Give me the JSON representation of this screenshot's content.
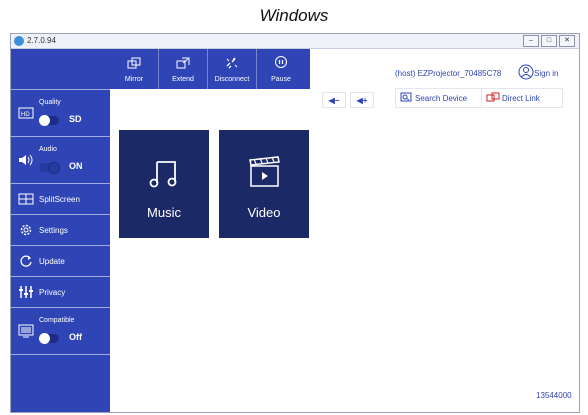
{
  "caption": "Windows",
  "window": {
    "version": "2.7.0.94",
    "controls": [
      "minimize-icon",
      "maximize-icon",
      "close-icon"
    ]
  },
  "toolbar": {
    "buttons": [
      {
        "label": "Mirror",
        "icon": "mirror-icon"
      },
      {
        "label": "Extend",
        "icon": "extend-icon"
      },
      {
        "label": "Disconnect",
        "icon": "disconnect-icon"
      },
      {
        "label": "Pause",
        "icon": "pause-icon"
      }
    ]
  },
  "sidebar": {
    "quality": {
      "label": "Quality",
      "value": "SD",
      "icon": "hd-icon",
      "toggle_on": false
    },
    "audio": {
      "label": "Audio",
      "value": "ON",
      "icon": "speaker-icon",
      "toggle_on": true
    },
    "items": [
      {
        "label": "SplitScreen",
        "icon": "split-screen-icon"
      },
      {
        "label": "Settings",
        "icon": "gear-icon"
      },
      {
        "label": "Update",
        "icon": "refresh-icon"
      },
      {
        "label": "Privacy",
        "icon": "sliders-icon"
      }
    ],
    "compatible": {
      "label": "Compatible",
      "value": "Off",
      "icon": "monitor-icon",
      "toggle_on": false
    }
  },
  "header": {
    "host": "(host) EZProjector_70485C78",
    "sign_in": "Sign in"
  },
  "controls": {
    "volume_down": "◀−",
    "volume_up": "◀+",
    "search_device": "Search Device",
    "direct_link": "Direct Link"
  },
  "tiles": [
    {
      "label": "Music",
      "icon": "music-icon"
    },
    {
      "label": "Video",
      "icon": "video-clapper-icon"
    }
  ],
  "footer": {
    "code": "13544000"
  },
  "colors": {
    "accent": "#2f45b5",
    "tile": "#1b2a66"
  }
}
